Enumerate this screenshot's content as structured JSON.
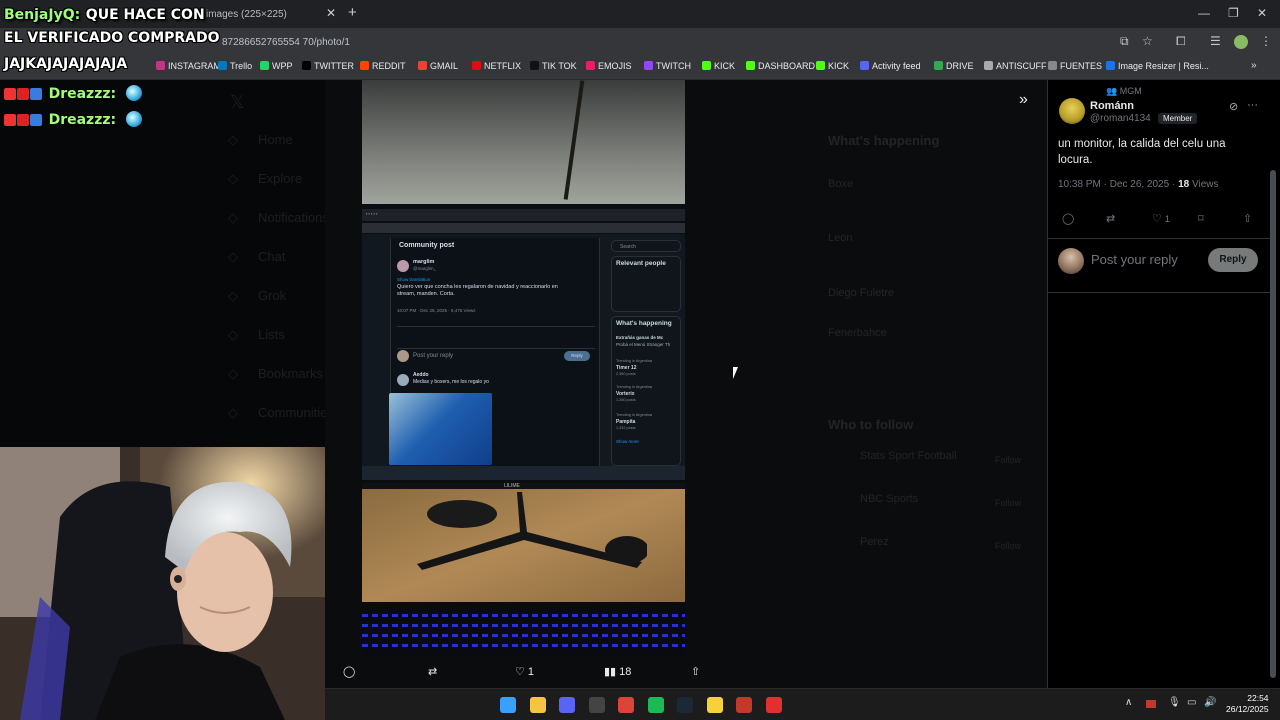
{
  "browser": {
    "tab_title": "images (225×225)",
    "url": "87286652765554 70/photo/1",
    "bookmarks": [
      {
        "label": "INSTAGRAM",
        "color": "#c13584"
      },
      {
        "label": "Trello",
        "color": "#0079bf"
      },
      {
        "label": "WPP",
        "color": "#25d366"
      },
      {
        "label": "TWITTER",
        "color": "#000000"
      },
      {
        "label": "REDDIT",
        "color": "#ff4500"
      },
      {
        "label": "GMAIL",
        "color": "#ea4335"
      },
      {
        "label": "NETFLIX",
        "color": "#e50914"
      },
      {
        "label": "TIK TOK",
        "color": "#111111"
      },
      {
        "label": "EMOJIS",
        "color": "#e91e63"
      },
      {
        "label": "TWITCH",
        "color": "#9146ff"
      },
      {
        "label": "KICK",
        "color": "#53fc18"
      },
      {
        "label": "DASHBOARD",
        "color": "#53fc18"
      },
      {
        "label": "KICK",
        "color": "#53fc18"
      },
      {
        "label": "Activity feed",
        "color": "#5865f2"
      },
      {
        "label": "DRIVE",
        "color": "#34a853"
      },
      {
        "label": "ANTISCUFF",
        "color": "#aaaaaa"
      },
      {
        "label": "FUENTES",
        "color": "#888888"
      },
      {
        "label": "Image Resizer | Resi...",
        "color": "#1a73e8"
      }
    ]
  },
  "chat_overlay": {
    "message": {
      "user": "BenjaJyQ:",
      "lines": [
        "QUE HACE CON",
        "EL VERIFICADO COMPRADO",
        "JAJKAJAJAJAJAJA"
      ]
    },
    "entries": [
      {
        "user": "Dreazzz:"
      },
      {
        "user": "Dreazzz:"
      }
    ]
  },
  "left_nav": [
    "Home",
    "Explore",
    "Notifications",
    "Chat",
    "Grok",
    "Lists",
    "Bookmarks",
    "Communities"
  ],
  "photo_actions": {
    "likes": "1",
    "views": "18"
  },
  "photo_content": {
    "inner_title": "Community post",
    "inner_author": "marglim",
    "inner_handle": "@marglim_",
    "inner_translate": "Show translation",
    "inner_text": "Quiero ver que concha les regalaron de navidad y reaccionarlo en stream, manden. Corta.",
    "inner_meta": "10:07 PM · Dec 25, 2025 · 5,476 Views",
    "inner_reply": "Post your reply",
    "inner_reply_btn": "Reply",
    "inner_comment_author": "Aeddo",
    "inner_comment_text": "Medias y boxers, me los regalo yo",
    "inner_search": "Search",
    "relevant_people": "Relevant people",
    "whats_happening": "What's happening",
    "promo_title": "Extrañás ganas de Mc",
    "promo_text": "Probá el Menú Stranger Th",
    "trend1_label": "Trending in Argentina",
    "trend1": "Timer 12",
    "trend1_posts": "2,360 posts",
    "trend2_label": "Trending in Argentina",
    "trend2": "Vorterix",
    "trend2_posts": "1,280 posts",
    "trend3_label": "Trending in Argentina",
    "trend3": "Pampita",
    "trend3_posts": "1,342 posts",
    "show_more": "Show more",
    "monitor_brand": "LILIME"
  },
  "background_sidebar": {
    "whats_happening": "What's happening",
    "who_to_follow": "Who to follow",
    "trends": [
      "Boxe",
      "Leon",
      "Diego Fuletre",
      "Fenerbahce"
    ],
    "follow_accounts": [
      "Stats Sport Football",
      "NBC Sports",
      "Perez"
    ],
    "follow_label": "Follow"
  },
  "post": {
    "community": "MGM",
    "author": "Románn",
    "handle": "@roman4134",
    "badge": "Member",
    "text": "un monitor, la calida del celu una locura.",
    "time": "10:38 PM · Dec 26, 2025 ·",
    "views_count": "18",
    "views_label": "Views",
    "likes": "1",
    "reply_placeholder": "Post your reply",
    "reply_button": "Reply"
  },
  "taskbar": {
    "time": "22:54",
    "date": "26/12/2025",
    "apps": [
      {
        "name": "windows-start",
        "color": "#3aa0ff"
      },
      {
        "name": "file-explorer",
        "color": "#f4c542"
      },
      {
        "name": "discord",
        "color": "#5865f2"
      },
      {
        "name": "obs",
        "color": "#444444"
      },
      {
        "name": "chrome",
        "color": "#db4437"
      },
      {
        "name": "spotify",
        "color": "#1db954"
      },
      {
        "name": "steam",
        "color": "#1b2838"
      },
      {
        "name": "sticky-notes",
        "color": "#f7d13b"
      },
      {
        "name": "app-red",
        "color": "#c0392b"
      },
      {
        "name": "app-red-2",
        "color": "#e03030"
      }
    ]
  }
}
